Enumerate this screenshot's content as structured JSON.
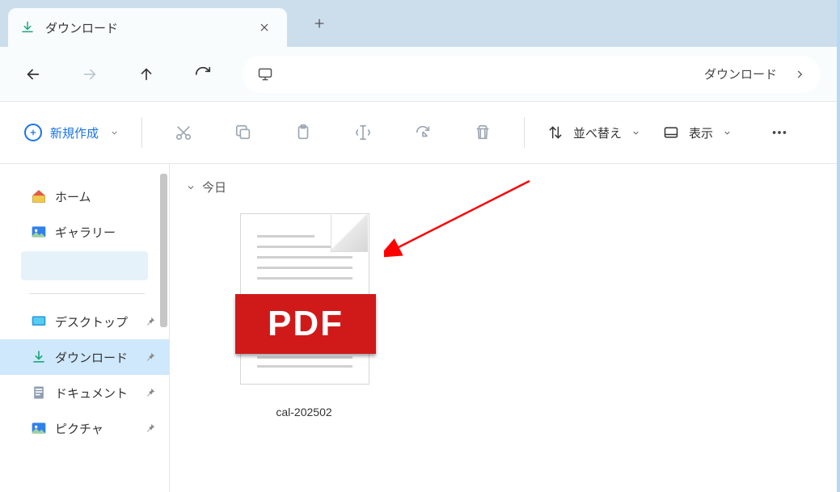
{
  "tab": {
    "title": "ダウンロード"
  },
  "address": {
    "right_label": "ダウンロード"
  },
  "toolbar": {
    "new_label": "新規作成",
    "sort_label": "並べ替え",
    "view_label": "表示"
  },
  "sidebar": {
    "items": [
      {
        "label": "ホーム"
      },
      {
        "label": "ギャラリー"
      },
      {
        "label": "デスクトップ"
      },
      {
        "label": "ダウンロード"
      },
      {
        "label": "ドキュメント"
      },
      {
        "label": "ピクチャ"
      }
    ]
  },
  "content": {
    "group_label": "今日",
    "files": [
      {
        "name": "cal-202502",
        "badge": "PDF"
      }
    ]
  }
}
